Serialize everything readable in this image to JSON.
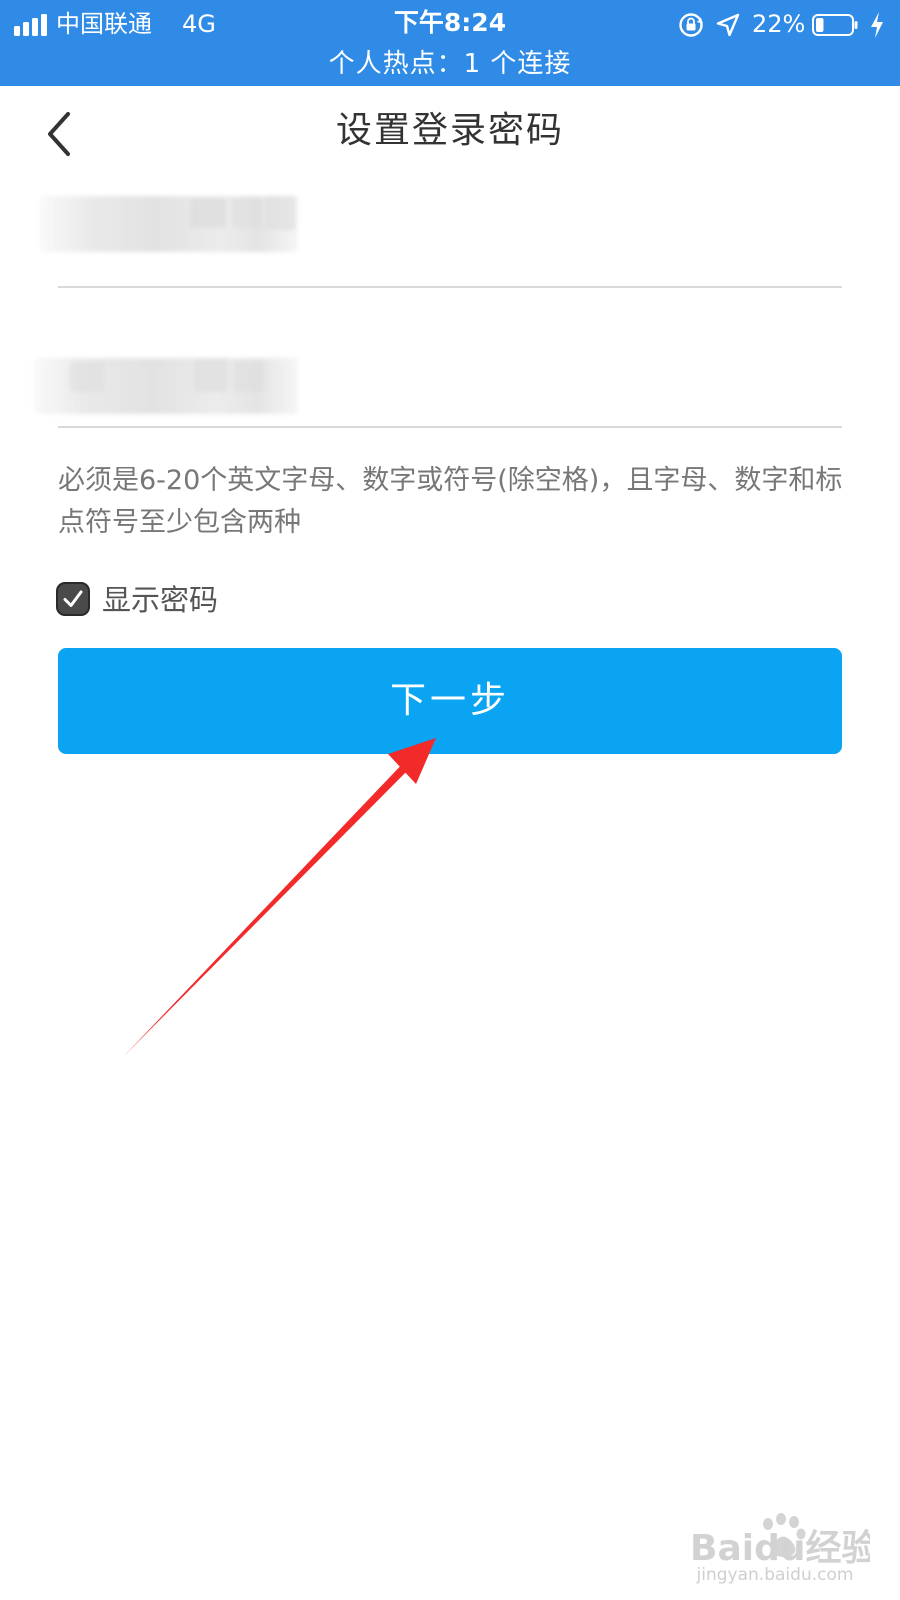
{
  "status_bar": {
    "carrier": "中国联通",
    "network": "4G",
    "time": "下午8:24",
    "battery_percent": "22%",
    "battery_level": 0.22,
    "hotspot": "个人热点：1 个连接",
    "background_color": "#2f8be6"
  },
  "nav": {
    "title": "设置登录密码",
    "back_icon": "chevron-left-icon"
  },
  "form": {
    "password": {
      "value": ""
    },
    "confirm_password": {
      "value": ""
    },
    "hint": "必须是6-20个英文字母、数字或符号(除空格)，且字母、数字和标点符号至少包含两种",
    "show_password_label": "显示密码",
    "show_password_checked": true
  },
  "next_button": {
    "label": "下一步",
    "color": "#0aa4f2"
  },
  "annotation": {
    "arrow_color": "#f22a2a"
  },
  "watermark": {
    "brand": "Baidu经验",
    "url": "jingyan.baidu.com"
  }
}
